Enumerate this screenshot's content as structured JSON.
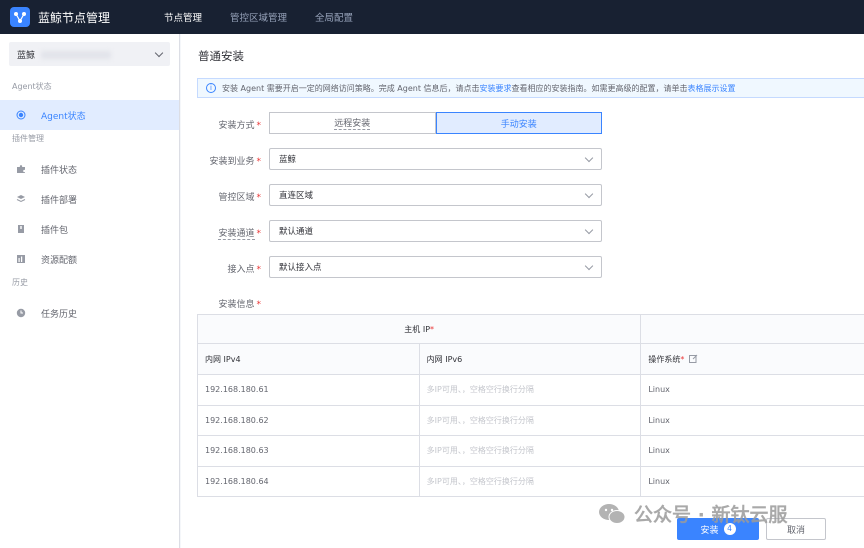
{
  "app": {
    "title": "蓝鲸节点管理",
    "nav": [
      "节点管理",
      "管控区域管理",
      "全局配置"
    ],
    "active_nav": 0
  },
  "sidebar": {
    "business_select": "蓝鲸",
    "groups": [
      {
        "title": "Agent状态",
        "items": [
          {
            "label": "Agent状态",
            "icon": "radio-dot-icon",
            "active": true
          }
        ]
      },
      {
        "title": "插件管理",
        "items": [
          {
            "label": "插件状态",
            "icon": "puzzle-icon"
          },
          {
            "label": "插件部署",
            "icon": "layers-icon"
          },
          {
            "label": "插件包",
            "icon": "package-icon"
          },
          {
            "label": "资源配额",
            "icon": "bar-chart-icon"
          }
        ]
      },
      {
        "title": "历史",
        "items": [
          {
            "label": "任务历史",
            "icon": "clock-icon"
          }
        ]
      }
    ]
  },
  "main": {
    "title": "普通安装",
    "info": {
      "text1": "安装 Agent 需要开启一定的网络访问策略。完成 Agent 信息后，请点击",
      "link1": "安装要求",
      "text2": "查看相应的安装指南。如需更高级的配置，请单击",
      "link2": "表格展示设置"
    },
    "form": {
      "install_mode_label": "安装方式",
      "install_modes": [
        "远程安装",
        "手动安装"
      ],
      "active_mode": 1,
      "business_label": "安装到业务",
      "business_value": "蓝鲸",
      "cloud_label": "管控区域",
      "cloud_value": "直连区域",
      "channel_label": "安装通道",
      "channel_value": "默认通道",
      "access_label": "接入点",
      "access_value": "默认接入点",
      "install_info_label": "安装信息"
    },
    "table": {
      "group_header": "主机 IP",
      "columns": [
        "内网 IPv4",
        "内网 IPv6",
        "操作系统"
      ],
      "placeholder": "多IP可用、，空格空行换行分隔",
      "rows": [
        {
          "ipv4": "192.168.180.61",
          "os": "Linux"
        },
        {
          "ipv4": "192.168.180.62",
          "os": "Linux"
        },
        {
          "ipv4": "192.168.180.63",
          "os": "Linux"
        },
        {
          "ipv4": "192.168.180.64",
          "os": "Linux"
        }
      ]
    },
    "buttons": {
      "install": "安装",
      "install_count": "4",
      "cancel": "取消"
    }
  },
  "watermark": "公众号 · 新钛云服",
  "colors": {
    "primary": "#3a84ff",
    "topbar": "#182132",
    "required": "#ea3636"
  }
}
